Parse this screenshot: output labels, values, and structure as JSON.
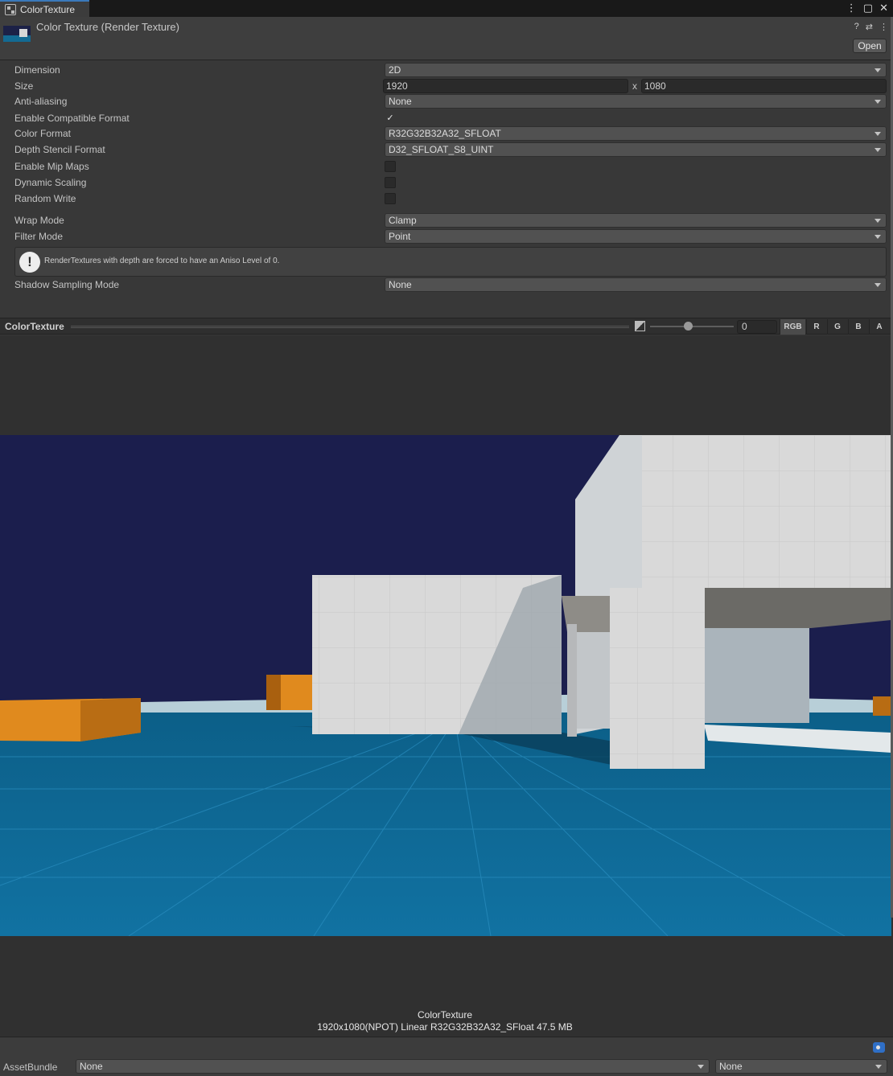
{
  "tab": {
    "title": "ColorTexture"
  },
  "header": {
    "title": "Color Texture (Render Texture)",
    "open_label": "Open"
  },
  "properties": {
    "dimension": {
      "label": "Dimension",
      "value": "2D"
    },
    "size": {
      "label": "Size",
      "width": "1920",
      "sep": "x",
      "height": "1080"
    },
    "anti_aliasing": {
      "label": "Anti-aliasing",
      "value": "None"
    },
    "compatible_format": {
      "label": "Enable Compatible Format",
      "checked": true,
      "mark": "✓"
    },
    "color_format": {
      "label": "Color Format",
      "value": "R32G32B32A32_SFLOAT"
    },
    "depth_stencil": {
      "label": "Depth Stencil Format",
      "value": "D32_SFLOAT_S8_UINT"
    },
    "mip_maps": {
      "label": "Enable Mip Maps",
      "checked": false
    },
    "dynamic_scaling": {
      "label": "Dynamic Scaling",
      "checked": false
    },
    "random_write": {
      "label": "Random Write",
      "checked": false
    },
    "wrap_mode": {
      "label": "Wrap Mode",
      "value": "Clamp"
    },
    "filter_mode": {
      "label": "Filter Mode",
      "value": "Point"
    },
    "help": {
      "icon": "!",
      "text": "RenderTextures with depth are forced to have an Aniso Level of 0."
    },
    "shadow_sampling": {
      "label": "Shadow Sampling Mode",
      "value": "None"
    }
  },
  "preview": {
    "title": "ColorTexture",
    "mip_value": "0",
    "mip_level": 0.45,
    "channels": [
      "RGB",
      "R",
      "G",
      "B",
      "A"
    ],
    "active_channel": "RGB",
    "info_name": "ColorTexture",
    "info_line": "1920x1080(NPOT) Linear  R32G32B32A32_SFloat  47.5 MB"
  },
  "asset_bundle": {
    "label": "AssetBundle",
    "name": "None",
    "variant": "None"
  },
  "colors": {
    "accent": "#3a79bb",
    "sky": "#1b1e4d",
    "floor": "#106a96",
    "wall": "#d6d6d6",
    "crate": "#e08a1e"
  }
}
